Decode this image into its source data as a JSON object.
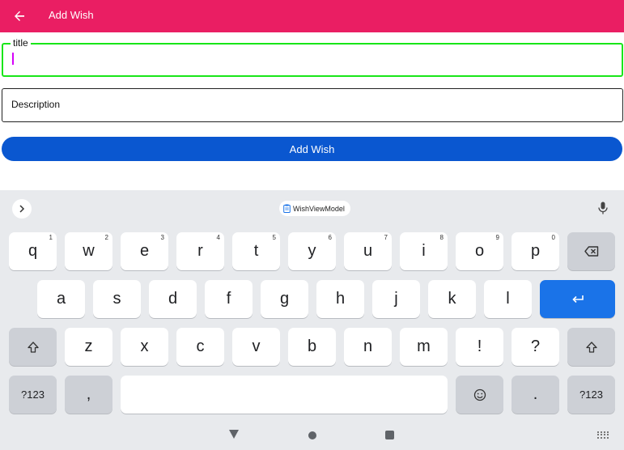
{
  "appbar": {
    "title": "Add Wish",
    "color": "#ea1e63"
  },
  "form": {
    "title_label": "title",
    "title_value": "",
    "description_label": "Description",
    "description_value": "",
    "submit_label": "Add Wish",
    "focus_color": "#19e619",
    "button_color": "#0a57d0"
  },
  "keyboard": {
    "suggestion": "WishViewModel",
    "row1": [
      {
        "label": "q",
        "hint": "1"
      },
      {
        "label": "w",
        "hint": "2"
      },
      {
        "label": "e",
        "hint": "3"
      },
      {
        "label": "r",
        "hint": "4"
      },
      {
        "label": "t",
        "hint": "5"
      },
      {
        "label": "y",
        "hint": "6"
      },
      {
        "label": "u",
        "hint": "7"
      },
      {
        "label": "i",
        "hint": "8"
      },
      {
        "label": "o",
        "hint": "9"
      },
      {
        "label": "p",
        "hint": "0"
      }
    ],
    "row2": [
      "a",
      "s",
      "d",
      "f",
      "g",
      "h",
      "j",
      "k",
      "l"
    ],
    "row3": [
      "z",
      "x",
      "c",
      "v",
      "b",
      "n",
      "m",
      "!",
      "?"
    ],
    "row4": {
      "symbols_left": "?123",
      "comma": ",",
      "period": ".",
      "symbols_right": "?123"
    },
    "enter_color": "#1a73e8"
  }
}
